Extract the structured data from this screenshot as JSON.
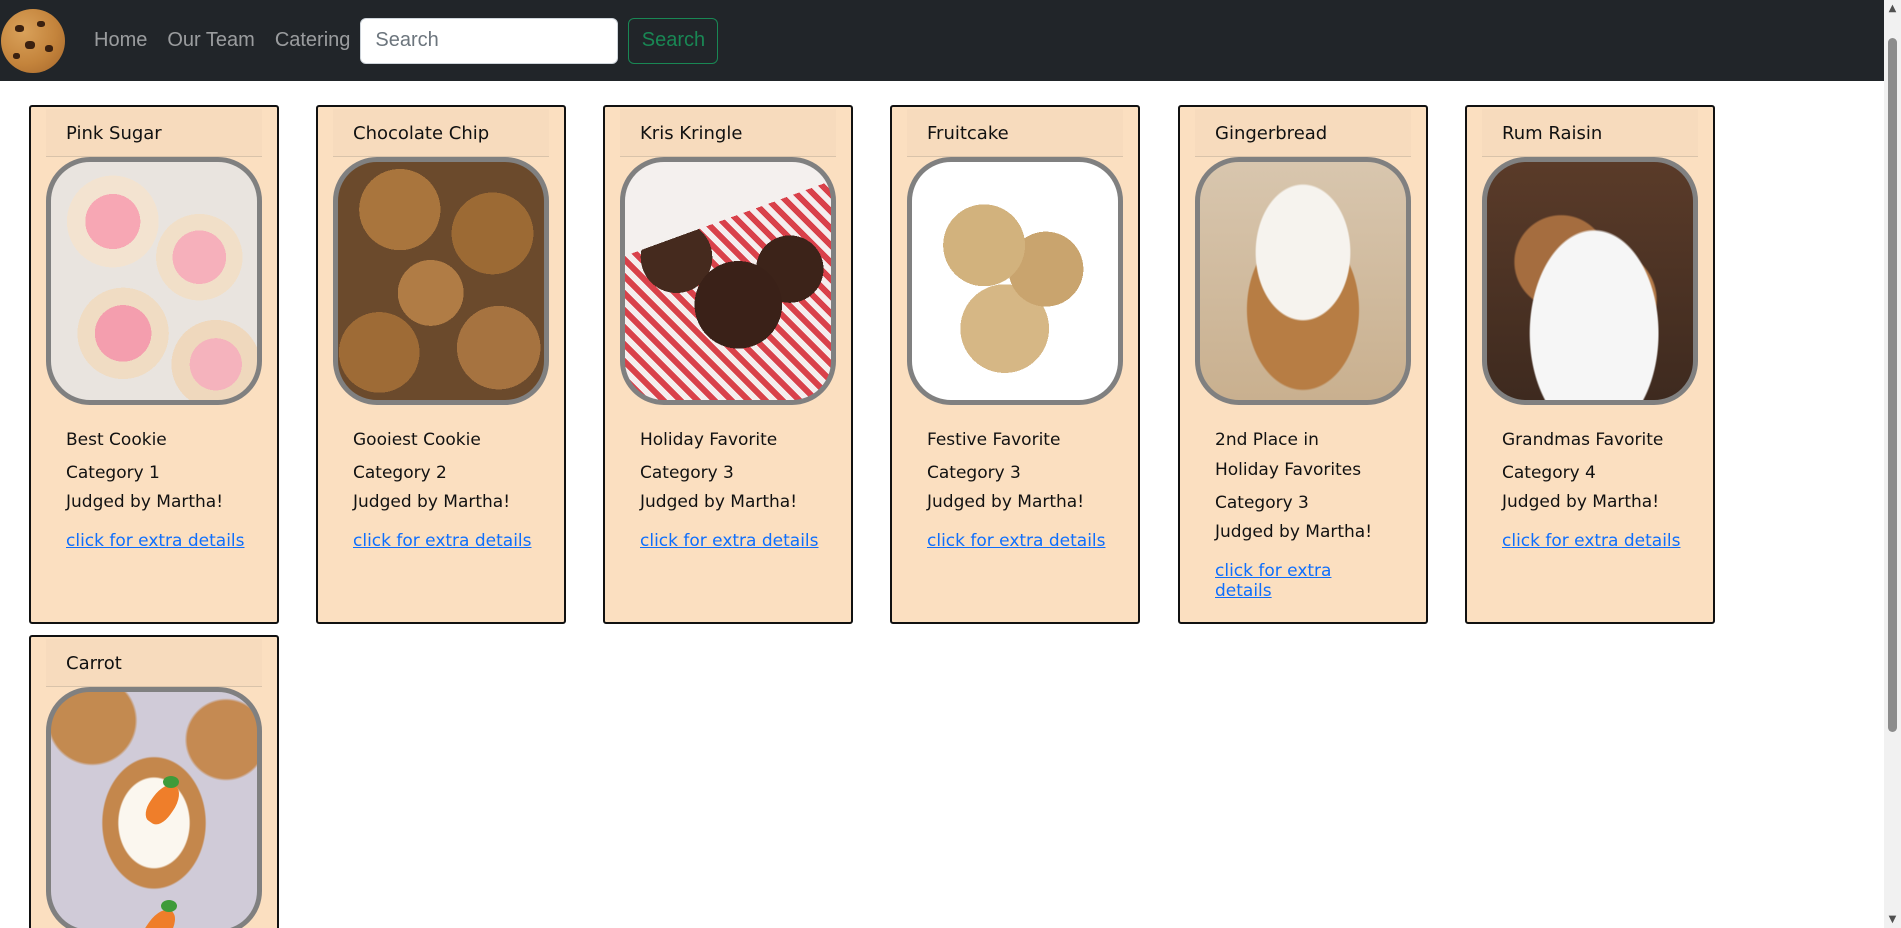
{
  "navbar": {
    "links": [
      "Home",
      "Our Team",
      "Catering"
    ],
    "search_placeholder": "Search",
    "search_button": "Search"
  },
  "cards": [
    {
      "name": "Pink Sugar",
      "title": "Best Cookie",
      "category": "Category 1",
      "judge": "Judged by Martha!",
      "link": "click for extra details"
    },
    {
      "name": "Chocolate Chip",
      "title": "Gooiest Cookie",
      "category": "Category 2",
      "judge": "Judged by Martha!",
      "link": "click for extra details"
    },
    {
      "name": "Kris Kringle",
      "title": "Holiday Favorite",
      "category": "Category 3",
      "judge": "Judged by Martha!",
      "link": "click for extra details"
    },
    {
      "name": "Fruitcake",
      "title": "Festive Favorite",
      "category": "Category 3",
      "judge": "Judged by Martha!",
      "link": "click for extra details"
    },
    {
      "name": "Gingerbread",
      "title": "2nd Place in Holiday Favorites",
      "category": "Category 3",
      "judge": "Judged by Martha!",
      "link": "click for extra details"
    },
    {
      "name": "Rum Raisin",
      "title": "Grandmas Favorite",
      "category": "Category 4",
      "judge": "Judged by Martha!",
      "link": "click for extra details"
    },
    {
      "name": "Carrot"
    }
  ]
}
